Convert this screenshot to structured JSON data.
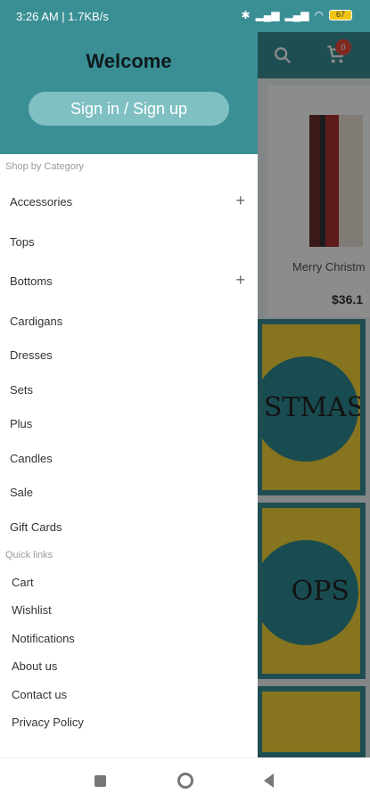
{
  "status": {
    "time": "3:26 AM | 1.7KB/s",
    "battery": "67"
  },
  "background": {
    "product_name": "Merry Christm",
    "product_price": "$36.1",
    "tile1_text": "ISTMAS",
    "tile2_text": "OPS",
    "cart_count": "0"
  },
  "drawer": {
    "welcome": "Welcome",
    "signin": "Sign in / Sign up",
    "shop_label": "Shop by Category",
    "categories": [
      {
        "label": "Accessories",
        "plus": "+"
      },
      {
        "label": "Tops"
      },
      {
        "label": "Bottoms",
        "plus": "+"
      },
      {
        "label": "Cardigans"
      },
      {
        "label": "Dresses"
      },
      {
        "label": "Sets"
      },
      {
        "label": "Plus"
      },
      {
        "label": "Candles"
      },
      {
        "label": "Sale"
      },
      {
        "label": "Gift Cards"
      }
    ],
    "quick_label": "Quick links",
    "quick_links": [
      "Cart",
      "Wishlist",
      "Notifications",
      "About us",
      "Contact us",
      "Privacy Policy"
    ]
  }
}
